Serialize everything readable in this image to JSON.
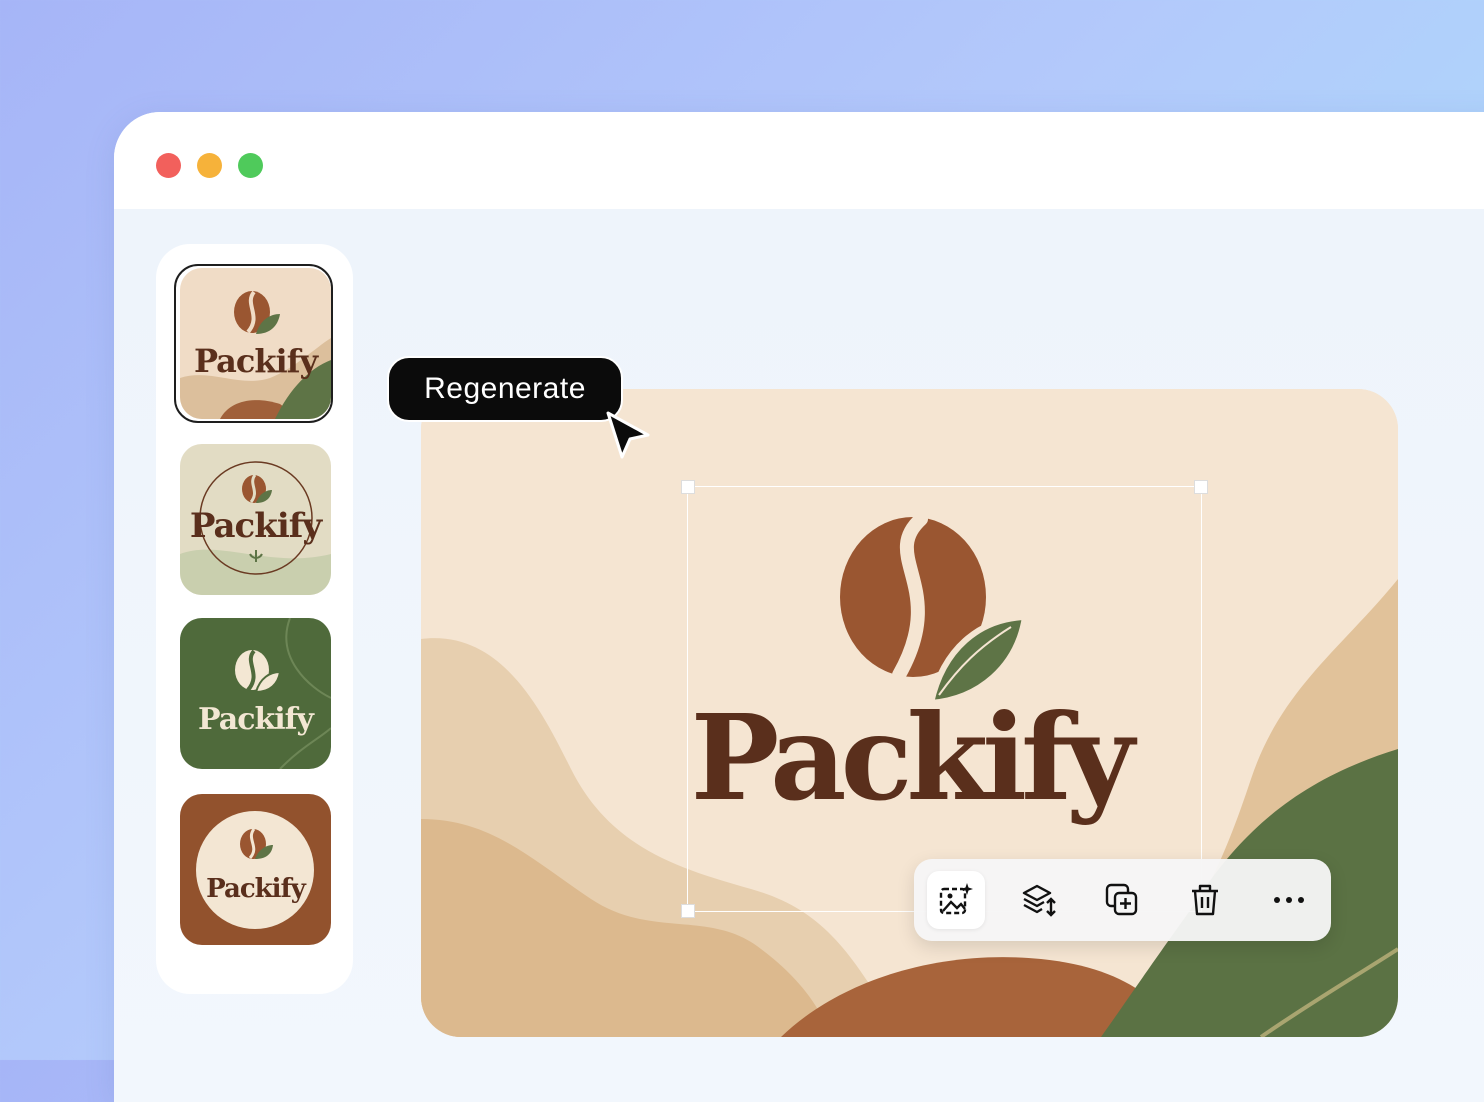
{
  "window": {
    "controls": [
      "close",
      "minimize",
      "maximize"
    ]
  },
  "sidebar": {
    "thumbnails": [
      {
        "label": "Packify",
        "selected": true,
        "style": "beige-waves"
      },
      {
        "label": "Packify",
        "selected": false,
        "style": "sage-badge"
      },
      {
        "label": "Packify",
        "selected": false,
        "style": "green-leaf"
      },
      {
        "label": "Packify",
        "selected": false,
        "style": "brown-circle"
      }
    ]
  },
  "canvas": {
    "brand_name": "Packify",
    "colors": {
      "background": "#f5e5d2",
      "text": "#5a2f1c",
      "bean": "#9a5631",
      "leaf": "#5e7446"
    }
  },
  "tooltip": {
    "label": "Regenerate"
  },
  "toolbar": {
    "tools": [
      {
        "icon": "image-sparkle-icon",
        "active": true
      },
      {
        "icon": "layers-icon",
        "active": false
      },
      {
        "icon": "duplicate-icon",
        "active": false
      },
      {
        "icon": "trash-icon",
        "active": false
      },
      {
        "icon": "more-icon",
        "active": false
      }
    ]
  }
}
